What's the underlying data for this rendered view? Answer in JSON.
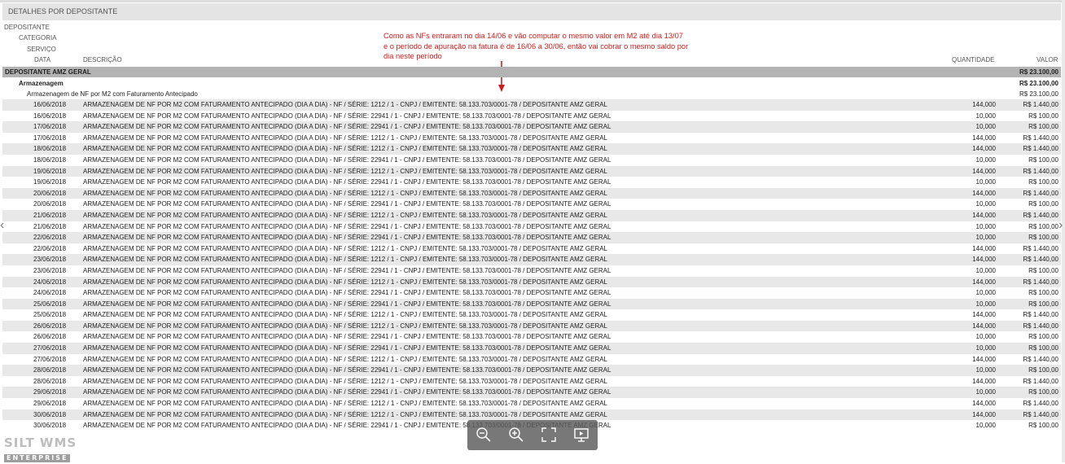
{
  "header": {
    "title": "DETALHES POR DEPOSITANTE"
  },
  "labels": {
    "depositante": "DEPOSITANTE",
    "categoria": "CATEGORIA",
    "servico": "SERVIÇO",
    "data": "DATA",
    "descricao": "DESCRIÇÃO",
    "quantidade": "QUANTIDADE",
    "valor": "VALOR"
  },
  "annotation": {
    "line1": "Como as NFs entraram no dia 14/06 e vão computar o mesmo valor em M2 até dia 13/07",
    "line2": "e o período de apuração na fatura é de 16/06 a 30/06, então vai cobrar o mesmo saldo por",
    "line3": "dia neste período",
    "color": "#d01c1c"
  },
  "depositante": {
    "name": "DEPOSITANTE AMZ GERAL",
    "total": "R$ 23.100,00"
  },
  "categoria": {
    "name": "Armazenagem",
    "total": "R$ 23.100,00"
  },
  "servico": {
    "name": "Armazenagem de NF por M2 com Faturamento Antecipado",
    "total": "R$ 23.100,00"
  },
  "rows": [
    {
      "date": "16/06/2018",
      "desc": "ARMAZENAGEM DE NF POR M2 COM FATURAMENTO ANTECIPADO (DIA A DIA) - NF / SÉRIE: 1212 / 1 - CNPJ / EMITENTE: 58.133.703/0001-78 / DEPOSITANTE AMZ GERAL",
      "qty": "144,000",
      "val": "R$ 1.440,00"
    },
    {
      "date": "16/06/2018",
      "desc": "ARMAZENAGEM DE NF POR M2 COM FATURAMENTO ANTECIPADO (DIA A DIA) - NF / SÉRIE: 22941 / 1 - CNPJ / EMITENTE: 58.133.703/0001-78 / DEPOSITANTE AMZ GERAL",
      "qty": "10,000",
      "val": "R$ 100,00"
    },
    {
      "date": "17/06/2018",
      "desc": "ARMAZENAGEM DE NF POR M2 COM FATURAMENTO ANTECIPADO (DIA A DIA) - NF / SÉRIE: 22941 / 1 - CNPJ / EMITENTE: 58.133.703/0001-78 / DEPOSITANTE AMZ GERAL",
      "qty": "10,000",
      "val": "R$ 100,00"
    },
    {
      "date": "17/06/2018",
      "desc": "ARMAZENAGEM DE NF POR M2 COM FATURAMENTO ANTECIPADO (DIA A DIA) - NF / SÉRIE: 1212 / 1 - CNPJ / EMITENTE: 58.133.703/0001-78 / DEPOSITANTE AMZ GERAL",
      "qty": "144,000",
      "val": "R$ 1.440,00"
    },
    {
      "date": "18/06/2018",
      "desc": "ARMAZENAGEM DE NF POR M2 COM FATURAMENTO ANTECIPADO (DIA A DIA) - NF / SÉRIE: 1212 / 1 - CNPJ / EMITENTE: 58.133.703/0001-78 / DEPOSITANTE AMZ GERAL",
      "qty": "144,000",
      "val": "R$ 1.440,00"
    },
    {
      "date": "18/06/2018",
      "desc": "ARMAZENAGEM DE NF POR M2 COM FATURAMENTO ANTECIPADO (DIA A DIA) - NF / SÉRIE: 22941 / 1 - CNPJ / EMITENTE: 58.133.703/0001-78 / DEPOSITANTE AMZ GERAL",
      "qty": "10,000",
      "val": "R$ 100,00"
    },
    {
      "date": "19/06/2018",
      "desc": "ARMAZENAGEM DE NF POR M2 COM FATURAMENTO ANTECIPADO (DIA A DIA) - NF / SÉRIE: 1212 / 1 - CNPJ / EMITENTE: 58.133.703/0001-78 / DEPOSITANTE AMZ GERAL",
      "qty": "144,000",
      "val": "R$ 1.440,00"
    },
    {
      "date": "19/06/2018",
      "desc": "ARMAZENAGEM DE NF POR M2 COM FATURAMENTO ANTECIPADO (DIA A DIA) - NF / SÉRIE: 22941 / 1 - CNPJ / EMITENTE: 58.133.703/0001-78 / DEPOSITANTE AMZ GERAL",
      "qty": "10,000",
      "val": "R$ 100,00"
    },
    {
      "date": "20/06/2018",
      "desc": "ARMAZENAGEM DE NF POR M2 COM FATURAMENTO ANTECIPADO (DIA A DIA) - NF / SÉRIE: 1212 / 1 - CNPJ / EMITENTE: 58.133.703/0001-78 / DEPOSITANTE AMZ GERAL",
      "qty": "144,000",
      "val": "R$ 1.440,00"
    },
    {
      "date": "20/06/2018",
      "desc": "ARMAZENAGEM DE NF POR M2 COM FATURAMENTO ANTECIPADO (DIA A DIA) - NF / SÉRIE: 22941 / 1 - CNPJ / EMITENTE: 58.133.703/0001-78 / DEPOSITANTE AMZ GERAL",
      "qty": "10,000",
      "val": "R$ 100,00"
    },
    {
      "date": "21/06/2018",
      "desc": "ARMAZENAGEM DE NF POR M2 COM FATURAMENTO ANTECIPADO (DIA A DIA) - NF / SÉRIE: 1212 / 1 - CNPJ / EMITENTE: 58.133.703/0001-78 / DEPOSITANTE AMZ GERAL",
      "qty": "144,000",
      "val": "R$ 1.440,00"
    },
    {
      "date": "21/06/2018",
      "desc": "ARMAZENAGEM DE NF POR M2 COM FATURAMENTO ANTECIPADO (DIA A DIA) - NF / SÉRIE: 22941 / 1 - CNPJ / EMITENTE: 58.133.703/0001-78 / DEPOSITANTE AMZ GERAL",
      "qty": "10,000",
      "val": "R$ 100,00"
    },
    {
      "date": "22/06/2018",
      "desc": "ARMAZENAGEM DE NF POR M2 COM FATURAMENTO ANTECIPADO (DIA A DIA) - NF / SÉRIE: 22941 / 1 - CNPJ / EMITENTE: 58.133.703/0001-78 / DEPOSITANTE AMZ GERAL",
      "qty": "10,000",
      "val": "R$ 100,00"
    },
    {
      "date": "22/06/2018",
      "desc": "ARMAZENAGEM DE NF POR M2 COM FATURAMENTO ANTECIPADO (DIA A DIA) - NF / SÉRIE: 1212 / 1 - CNPJ / EMITENTE: 58.133.703/0001-78 / DEPOSITANTE AMZ GERAL",
      "qty": "144,000",
      "val": "R$ 1.440,00"
    },
    {
      "date": "23/06/2018",
      "desc": "ARMAZENAGEM DE NF POR M2 COM FATURAMENTO ANTECIPADO (DIA A DIA) - NF / SÉRIE: 1212 / 1 - CNPJ / EMITENTE: 58.133.703/0001-78 / DEPOSITANTE AMZ GERAL",
      "qty": "144,000",
      "val": "R$ 1.440,00"
    },
    {
      "date": "23/06/2018",
      "desc": "ARMAZENAGEM DE NF POR M2 COM FATURAMENTO ANTECIPADO (DIA A DIA) - NF / SÉRIE: 22941 / 1 - CNPJ / EMITENTE: 58.133.703/0001-78 / DEPOSITANTE AMZ GERAL",
      "qty": "10,000",
      "val": "R$ 100,00"
    },
    {
      "date": "24/06/2018",
      "desc": "ARMAZENAGEM DE NF POR M2 COM FATURAMENTO ANTECIPADO (DIA A DIA) - NF / SÉRIE: 1212 / 1 - CNPJ / EMITENTE: 58.133.703/0001-78 / DEPOSITANTE AMZ GERAL",
      "qty": "144,000",
      "val": "R$ 1.440,00"
    },
    {
      "date": "24/06/2018",
      "desc": "ARMAZENAGEM DE NF POR M2 COM FATURAMENTO ANTECIPADO (DIA A DIA) - NF / SÉRIE: 22941 / 1 - CNPJ / EMITENTE: 58.133.703/0001-78 / DEPOSITANTE AMZ GERAL",
      "qty": "10,000",
      "val": "R$ 100,00"
    },
    {
      "date": "25/06/2018",
      "desc": "ARMAZENAGEM DE NF POR M2 COM FATURAMENTO ANTECIPADO (DIA A DIA) - NF / SÉRIE: 22941 / 1 - CNPJ / EMITENTE: 58.133.703/0001-78 / DEPOSITANTE AMZ GERAL",
      "qty": "10,000",
      "val": "R$ 100,00"
    },
    {
      "date": "25/06/2018",
      "desc": "ARMAZENAGEM DE NF POR M2 COM FATURAMENTO ANTECIPADO (DIA A DIA) - NF / SÉRIE: 1212 / 1 - CNPJ / EMITENTE: 58.133.703/0001-78 / DEPOSITANTE AMZ GERAL",
      "qty": "144,000",
      "val": "R$ 1.440,00"
    },
    {
      "date": "26/06/2018",
      "desc": "ARMAZENAGEM DE NF POR M2 COM FATURAMENTO ANTECIPADO (DIA A DIA) - NF / SÉRIE: 1212 / 1 - CNPJ / EMITENTE: 58.133.703/0001-78 / DEPOSITANTE AMZ GERAL",
      "qty": "144,000",
      "val": "R$ 1.440,00"
    },
    {
      "date": "26/06/2018",
      "desc": "ARMAZENAGEM DE NF POR M2 COM FATURAMENTO ANTECIPADO (DIA A DIA) - NF / SÉRIE: 22941 / 1 - CNPJ / EMITENTE: 58.133.703/0001-78 / DEPOSITANTE AMZ GERAL",
      "qty": "10,000",
      "val": "R$ 100,00"
    },
    {
      "date": "27/06/2018",
      "desc": "ARMAZENAGEM DE NF POR M2 COM FATURAMENTO ANTECIPADO (DIA A DIA) - NF / SÉRIE: 22941 / 1 - CNPJ / EMITENTE: 58.133.703/0001-78 / DEPOSITANTE AMZ GERAL",
      "qty": "10,000",
      "val": "R$ 100,00"
    },
    {
      "date": "27/06/2018",
      "desc": "ARMAZENAGEM DE NF POR M2 COM FATURAMENTO ANTECIPADO (DIA A DIA) - NF / SÉRIE: 1212 / 1 - CNPJ / EMITENTE: 58.133.703/0001-78 / DEPOSITANTE AMZ GERAL",
      "qty": "144,000",
      "val": "R$ 1.440,00"
    },
    {
      "date": "28/06/2018",
      "desc": "ARMAZENAGEM DE NF POR M2 COM FATURAMENTO ANTECIPADO (DIA A DIA) - NF / SÉRIE: 22941 / 1 - CNPJ / EMITENTE: 58.133.703/0001-78 / DEPOSITANTE AMZ GERAL",
      "qty": "10,000",
      "val": "R$ 100,00"
    },
    {
      "date": "28/06/2018",
      "desc": "ARMAZENAGEM DE NF POR M2 COM FATURAMENTO ANTECIPADO (DIA A DIA) - NF / SÉRIE: 1212 / 1 - CNPJ / EMITENTE: 58.133.703/0001-78 / DEPOSITANTE AMZ GERAL",
      "qty": "144,000",
      "val": "R$ 1.440,00"
    },
    {
      "date": "29/06/2018",
      "desc": "ARMAZENAGEM DE NF POR M2 COM FATURAMENTO ANTECIPADO (DIA A DIA) - NF / SÉRIE: 22941 / 1 - CNPJ / EMITENTE: 58.133.703/0001-78 / DEPOSITANTE AMZ GERAL",
      "qty": "10,000",
      "val": "R$ 100,00"
    },
    {
      "date": "29/06/2018",
      "desc": "ARMAZENAGEM DE NF POR M2 COM FATURAMENTO ANTECIPADO (DIA A DIA) - NF / SÉRIE: 1212 / 1 - CNPJ / EMITENTE: 58.133.703/0001-78 / DEPOSITANTE AMZ GERAL",
      "qty": "144,000",
      "val": "R$ 1.440,00"
    },
    {
      "date": "30/06/2018",
      "desc": "ARMAZENAGEM DE NF POR M2 COM FATURAMENTO ANTECIPADO (DIA A DIA) - NF / SÉRIE: 1212 / 1 - CNPJ / EMITENTE: 58.133.703/0001-78 / DEPOSITANTE AMZ GERAL",
      "qty": "144,000",
      "val": "R$ 1.440,00"
    },
    {
      "date": "30/06/2018",
      "desc": "ARMAZENAGEM DE NF POR M2 COM FATURAMENTO ANTECIPADO (DIA A DIA) - NF / SÉRIE: 22941 / 1 - CNPJ / EMITENTE: 58.133.703/0001-78 / DEPOSITANTE AMZ GERAL",
      "qty": "10,000",
      "val": "R$ 100,00"
    }
  ],
  "logo": {
    "line1": "SILT WMS",
    "line2": "ENTERPRISE"
  },
  "viewer": {
    "icons": [
      "zoom-out-icon",
      "zoom-in-icon",
      "fullscreen-icon",
      "present-icon"
    ]
  }
}
